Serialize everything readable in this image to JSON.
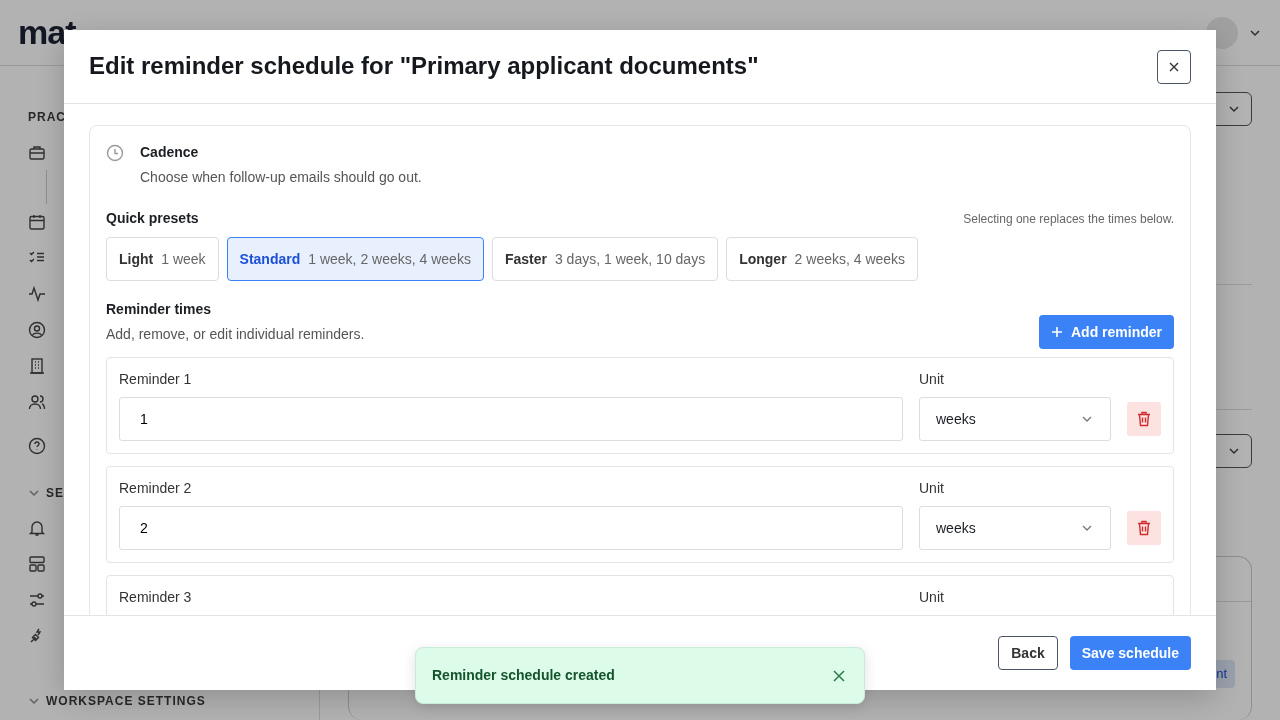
{
  "background": {
    "logo": "mat",
    "sidebar_sections": [
      {
        "label": "PRAC"
      },
      {
        "label": "SE",
        "expanded": true
      },
      {
        "label": "WORKSPACE SETTINGS",
        "expanded": true
      }
    ],
    "badge": "nt"
  },
  "modal": {
    "title": "Edit reminder schedule for \"Primary applicant documents\"",
    "cadence": {
      "title": "Cadence",
      "subtitle": "Choose when follow-up emails should go out."
    },
    "presets_label": "Quick presets",
    "presets_hint": "Selecting one replaces the times below.",
    "presets": [
      {
        "name": "Light",
        "times": "1 week",
        "selected": false
      },
      {
        "name": "Standard",
        "times": "1 week, 2 weeks, 4 weeks",
        "selected": true
      },
      {
        "name": "Faster",
        "times": "3 days, 1 week, 10 days",
        "selected": false
      },
      {
        "name": "Longer",
        "times": "2 weeks, 4 weeks",
        "selected": false
      }
    ],
    "reminders_title": "Reminder times",
    "reminders_subtitle": "Add, remove, or edit individual reminders.",
    "add_button": "Add reminder",
    "reminders": [
      {
        "label": "Reminder 1",
        "value": "1",
        "unit_label": "Unit",
        "unit": "weeks"
      },
      {
        "label": "Reminder 2",
        "value": "2",
        "unit_label": "Unit",
        "unit": "weeks"
      },
      {
        "label": "Reminder 3",
        "unit_label": "Unit"
      }
    ],
    "buttons": [
      {
        "label": "Back",
        "kind": "secondary"
      },
      {
        "label": "Save schedule",
        "kind": "primary"
      }
    ]
  },
  "toast": {
    "message": "Reminder schedule created"
  }
}
